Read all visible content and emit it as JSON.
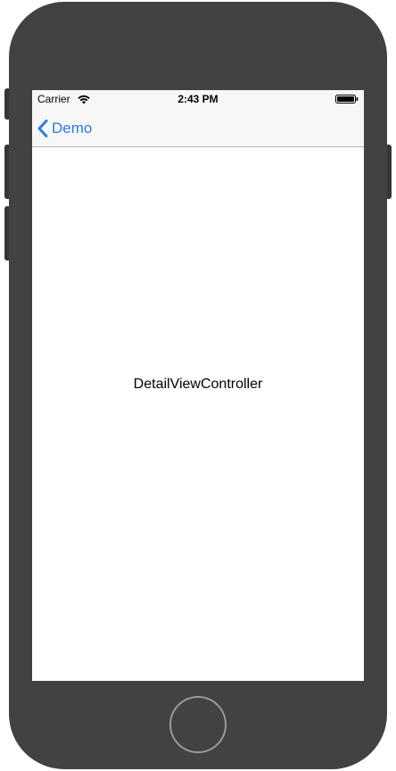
{
  "status_bar": {
    "carrier": "Carrier",
    "time": "2:43 PM",
    "wifi_icon": "wifi-icon",
    "battery_icon": "battery-icon"
  },
  "nav_bar": {
    "back_label": "Demo",
    "back_icon": "chevron-left-icon",
    "accent_color": "#2f7bde"
  },
  "content": {
    "label": "DetailViewController"
  },
  "device": {
    "body_color": "#424242",
    "home_button_icon": "home-button"
  }
}
